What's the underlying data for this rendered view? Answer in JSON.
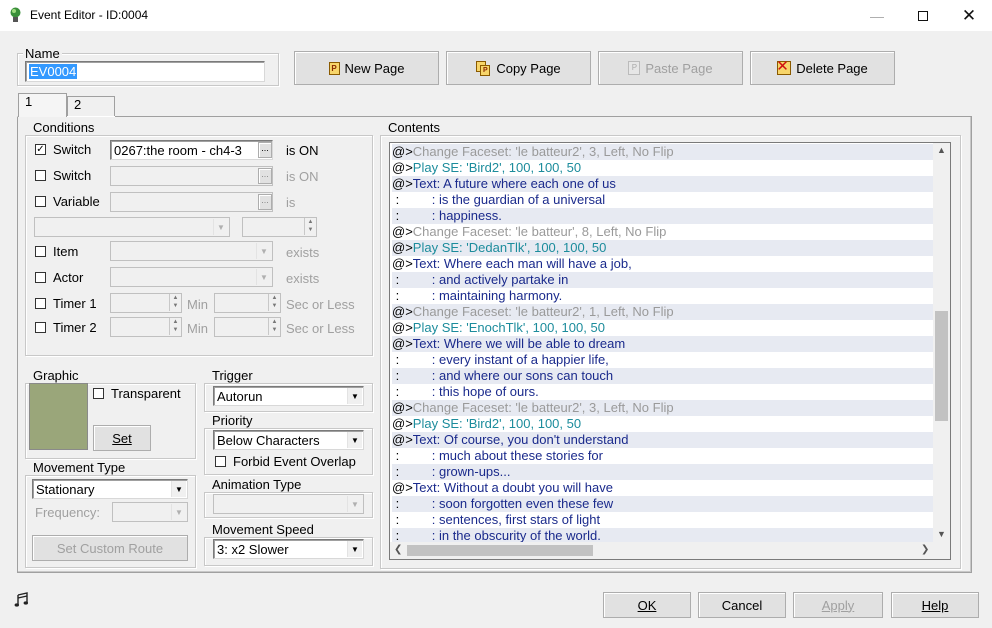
{
  "window": {
    "title": "Event Editor - ID:0004"
  },
  "name": {
    "label": "Name",
    "value": "EV0004"
  },
  "page_buttons": {
    "new": "New Page",
    "copy": "Copy Page",
    "paste": "Paste Page",
    "delete": "Delete Page"
  },
  "tabs": [
    {
      "label": "1"
    },
    {
      "label": "2"
    }
  ],
  "conditions": {
    "label": "Conditions",
    "switch1": {
      "label": "Switch",
      "value": "0267:the room - ch4-3",
      "suffix": "is ON",
      "checked": true
    },
    "switch2": {
      "label": "Switch",
      "value": "",
      "suffix": "is ON"
    },
    "variable": {
      "label": "Variable",
      "value": "",
      "suffix": "is"
    },
    "item": {
      "label": "Item",
      "suffix": "exists"
    },
    "actor": {
      "label": "Actor",
      "suffix": "exists"
    },
    "timer1": {
      "label": "Timer 1",
      "min": "Min",
      "sec": "Sec or Less"
    },
    "timer2": {
      "label": "Timer 2",
      "min": "Min",
      "sec": "Sec or Less"
    }
  },
  "graphic": {
    "label": "Graphic",
    "transparent": "Transparent",
    "set": "Set",
    "preview_color": "#9aa67a"
  },
  "trigger": {
    "label": "Trigger",
    "value": "Autorun"
  },
  "priority": {
    "label": "Priority",
    "value": "Below Characters",
    "forbid": "Forbid Event Overlap"
  },
  "movement_type": {
    "label": "Movement Type",
    "value": "Stationary",
    "frequency": "Frequency:",
    "custom_route": "Set Custom Route"
  },
  "animation_type": {
    "label": "Animation Type"
  },
  "movement_speed": {
    "label": "Movement Speed",
    "value": "3: x2 Slower"
  },
  "contents": {
    "label": "Contents",
    "lines": [
      {
        "prefix": "@>",
        "text": "Change Faceset: 'le batteur2', 3, Left, No Flip",
        "kind": "gray"
      },
      {
        "prefix": "@>",
        "text": "Play SE: 'Bird2', 100, 100, 50",
        "kind": "teal"
      },
      {
        "prefix": "@>",
        "text": "Text: A future where each one of us",
        "kind": "blue"
      },
      {
        "prefix": " :",
        "text": "         : is the guardian of a universal",
        "kind": "blue"
      },
      {
        "prefix": " :",
        "text": "         : happiness.",
        "kind": "blue"
      },
      {
        "prefix": "@>",
        "text": "Change Faceset: 'le batteur', 8, Left, No Flip",
        "kind": "gray"
      },
      {
        "prefix": "@>",
        "text": "Play SE: 'DedanTlk', 100, 100, 50",
        "kind": "teal"
      },
      {
        "prefix": "@>",
        "text": "Text: Where each man will have a job,",
        "kind": "blue"
      },
      {
        "prefix": " :",
        "text": "         : and actively partake in",
        "kind": "blue"
      },
      {
        "prefix": " :",
        "text": "         : maintaining harmony.",
        "kind": "blue"
      },
      {
        "prefix": "@>",
        "text": "Change Faceset: 'le batteur2', 1, Left, No Flip",
        "kind": "gray"
      },
      {
        "prefix": "@>",
        "text": "Play SE: 'EnochTlk', 100, 100, 50",
        "kind": "teal"
      },
      {
        "prefix": "@>",
        "text": "Text: Where we will be able to dream",
        "kind": "blue"
      },
      {
        "prefix": " :",
        "text": "         : every instant of a happier life,",
        "kind": "blue"
      },
      {
        "prefix": " :",
        "text": "         : and where our sons can touch",
        "kind": "blue"
      },
      {
        "prefix": " :",
        "text": "         : this hope of ours.",
        "kind": "blue"
      },
      {
        "prefix": "@>",
        "text": "Change Faceset: 'le batteur2', 3, Left, No Flip",
        "kind": "gray"
      },
      {
        "prefix": "@>",
        "text": "Play SE: 'Bird2', 100, 100, 50",
        "kind": "teal"
      },
      {
        "prefix": "@>",
        "text": "Text: Of course, you don't understand",
        "kind": "blue"
      },
      {
        "prefix": " :",
        "text": "         : much about these stories for",
        "kind": "blue"
      },
      {
        "prefix": " :",
        "text": "         : grown-ups...",
        "kind": "blue"
      },
      {
        "prefix": "@>",
        "text": "Text: Without a doubt you will have",
        "kind": "blue"
      },
      {
        "prefix": " :",
        "text": "         : soon forgotten even these few",
        "kind": "blue"
      },
      {
        "prefix": " :",
        "text": "         : sentences, first stars of light",
        "kind": "blue"
      },
      {
        "prefix": " :",
        "text": "         : in the obscurity of the world.",
        "kind": "blue"
      }
    ]
  },
  "footer": {
    "ok": "OK",
    "cancel": "Cancel",
    "apply": "Apply",
    "help": "Help"
  }
}
